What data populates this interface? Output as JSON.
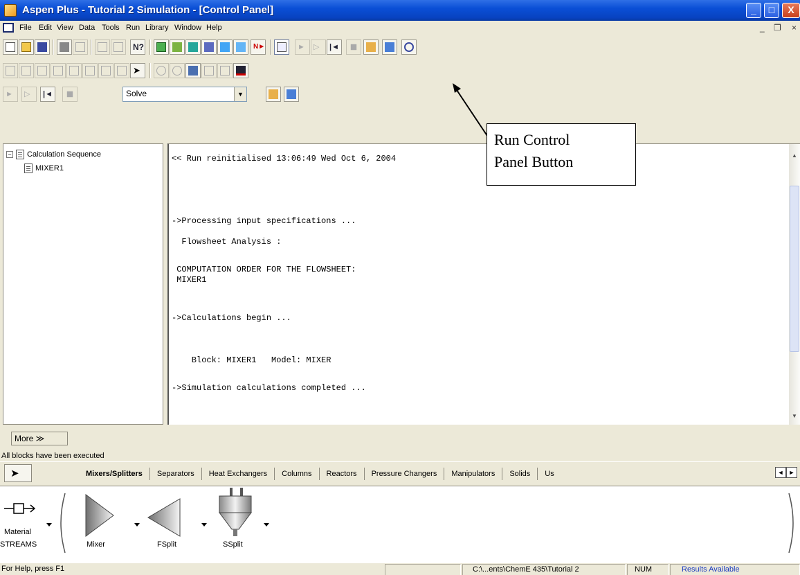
{
  "window": {
    "title": "Aspen Plus - Tutorial 2 Simulation - [Control Panel]",
    "min_glyph": "_",
    "max_glyph": "□",
    "close_glyph": "X"
  },
  "menu": [
    "File",
    "Edit",
    "View",
    "Data",
    "Tools",
    "Run",
    "Library",
    "Window",
    "Help"
  ],
  "mdi_controls": {
    "min": "_",
    "restore": "❐",
    "close": "×"
  },
  "run_toolbar": {
    "solve_select": "Solve"
  },
  "tree": {
    "root": "Calculation Sequence",
    "root_expander": "−",
    "child": "MIXER1"
  },
  "output_lines": [
    "<< Run reinitialised 13:06:49 Wed Oct 6, 2004",
    "->Processing input specifications ...",
    "  Flowsheet Analysis :",
    " COMPUTATION ORDER FOR THE FLOWSHEET:",
    " MIXER1",
    "->Calculations begin ...",
    "    Block: MIXER1   Model: MIXER",
    "->Simulation calculations completed ..."
  ],
  "callout": {
    "line1": "Run Control",
    "line2": "Panel Button"
  },
  "more_button": "More ≫",
  "status_message": "All blocks have been executed",
  "library_tabs": [
    "Mixers/Splitters",
    "Separators",
    "Heat Exchangers",
    "Columns",
    "Reactors",
    "Pressure Changers",
    "Manipulators",
    "Solids",
    "Us"
  ],
  "tab_scroll": {
    "left": "◄",
    "right": "►"
  },
  "library_items": {
    "streams_label_1": "Material",
    "streams_label_2": "STREAMS",
    "mixer": "Mixer",
    "fsplit": "FSplit",
    "ssplit": "SSplit"
  },
  "statusbar": {
    "help": "For Help, press F1",
    "path": "C:\\...ents\\ChemE 435\\Tutorial 2",
    "num": "NUM",
    "results": "Results Available"
  },
  "colors": {
    "titlebar": "#0a4fd6",
    "face": "#ece9d8",
    "results_text": "#1a3bbf"
  }
}
